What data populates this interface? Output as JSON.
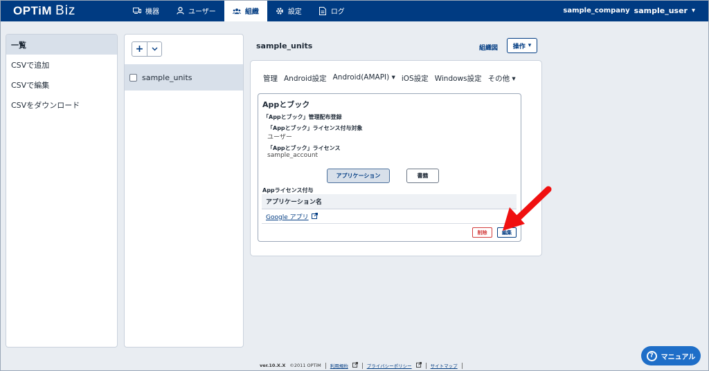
{
  "header": {
    "logo_brand": "OPTiM",
    "logo_product": "Biz",
    "nav": [
      {
        "label": "機器"
      },
      {
        "label": "ユーザー"
      },
      {
        "label": "組織"
      },
      {
        "label": "設定"
      },
      {
        "label": "ログ"
      }
    ],
    "company": "sample_company",
    "user": "sample_user"
  },
  "left_menu": {
    "items": [
      "一覧",
      "CSVで追加",
      "CSVで編集",
      "CSVをダウンロード"
    ]
  },
  "mid": {
    "add_label": "+",
    "unit_name": "sample_units"
  },
  "main": {
    "title": "sample_units",
    "org_chart_link": "組織図",
    "ops_label": "操作",
    "tabs": [
      "管理",
      "Android設定",
      "Android(AMAPI) ▾",
      "iOS設定",
      "Windows設定",
      "その他 ▾"
    ],
    "card": {
      "title": "Appとブック",
      "section_label": "「Appとブック」管理配布登録",
      "target_label": "「Appとブック」ライセンス付与対象",
      "target_value": "ユーザー",
      "license_label": "「Appとブック」ライセンス",
      "license_value": "sample_account",
      "seg_app": "アプリケーション",
      "seg_book": "書籍",
      "license_section": "Appライセンス付与",
      "table_header": "アプリケーション名",
      "rows": [
        "Google アプリ"
      ],
      "delete_label": "削除",
      "edit_label": "編集"
    }
  },
  "footer": {
    "version": "ver.10.X.X",
    "copyright": "©2011 OPTiM",
    "terms": "利用規約",
    "privacy": "プライバシーポリシー",
    "sitemap": "サイトマップ"
  },
  "manual_label": "マニュアル",
  "colors": {
    "header_bg": "#003b82",
    "accent": "#1e6ec8",
    "danger": "#d23a3a",
    "annotation_arrow": "#f01010"
  }
}
